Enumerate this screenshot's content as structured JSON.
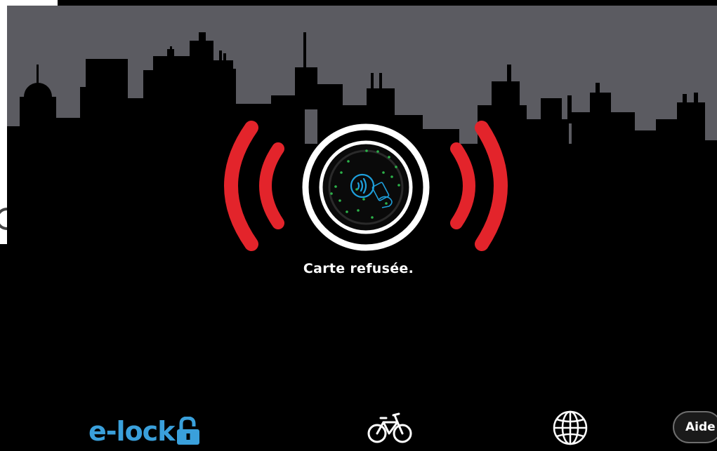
{
  "status": {
    "message": "Carte refusée.",
    "state": "card-refused"
  },
  "footer": {
    "logo_text": "e-lock",
    "logo_icon": "padlock-icon",
    "bike_icon": "bicycle-icon",
    "language_icon": "globe-icon",
    "help_label": "Aide"
  },
  "colors": {
    "background": "#000000",
    "sky": "#5b5b61",
    "refused_waves": "#e3242b",
    "logo": "#3aa0db",
    "contactless_symbol": "#1ea0dc",
    "reader_dots": "#2db34a"
  }
}
